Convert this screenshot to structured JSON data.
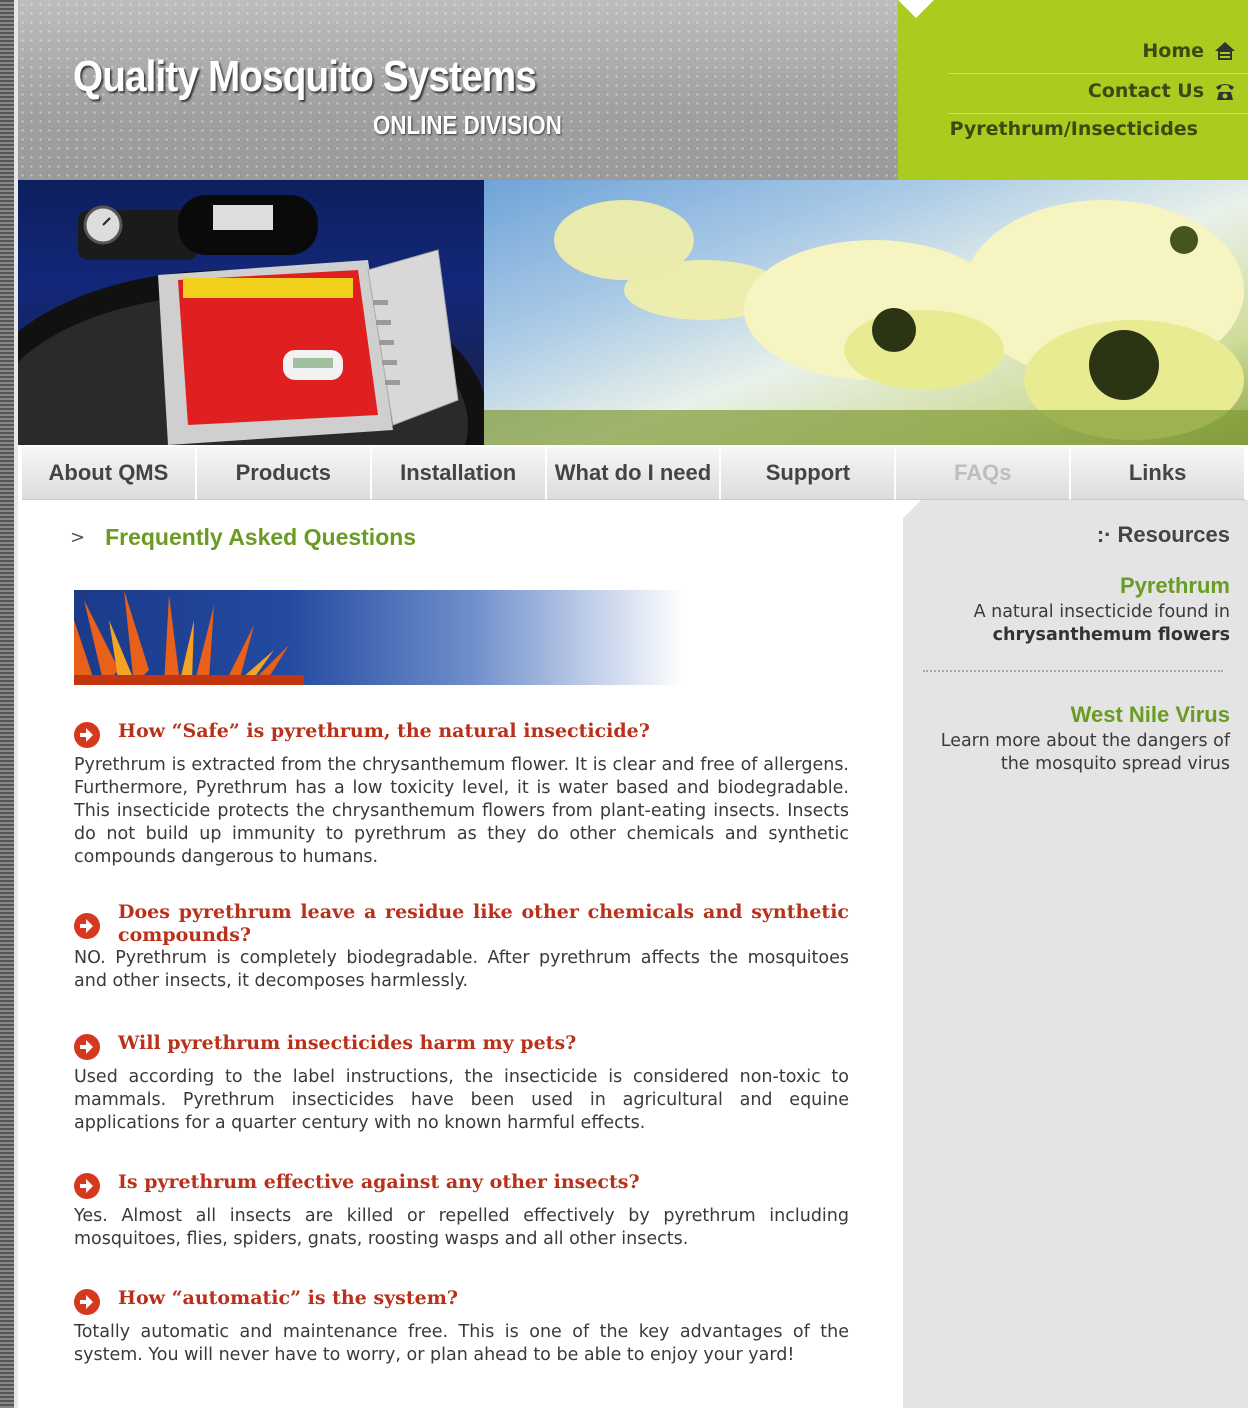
{
  "header": {
    "logo_main": "Quality Mosquito Systems",
    "logo_sub": "ONLINE DIVISION",
    "links": {
      "home": "Home",
      "contact": "Contact Us",
      "current": "Pyrethrum/Insecticides"
    },
    "icons": {
      "home": "home-icon",
      "contact": "telephone-icon"
    }
  },
  "banner": {
    "left_image": "mosquito-pro-control-unit-photo",
    "right_image": "chrysanthemum-flowers-photo"
  },
  "nav": {
    "items": [
      "About QMS",
      "Products",
      "Installation",
      "What do I need",
      "Support",
      "FAQs",
      "Links"
    ],
    "active": "FAQs"
  },
  "main": {
    "section_title": "Frequently Asked Questions",
    "faqs": [
      {
        "q": "How “Safe” is pyrethrum, the natural insecticide?",
        "a": "Pyrethrum is extracted from the chrysanthemum flower. It is clear and free of allergens. Furthermore, Pyrethrum has a low toxicity level, it is water based and biodegradable. This insecticide protects the chrysanthemum flowers from plant-eating insects. Insects do not build up immunity to pyrethrum as they do other chemicals and synthetic compounds dangerous to humans."
      },
      {
        "q": "Does pyrethrum leave a residue like other chemicals and synthetic compounds?",
        "a": "NO. Pyrethrum is completely biodegradable. After pyrethrum affects the mosquitoes and other insects, it decomposes harmlessly."
      },
      {
        "q": "Will pyrethrum insecticides harm my pets?",
        "a": "Used according to the label instructions, the insecticide is considered non-toxic to mammals. Pyrethrum insecticides have been used in agricultural and equine applications for a quarter century with no known harmful effects."
      },
      {
        "q": "Is pyrethrum effective against any other insects?",
        "a": "Yes. Almost all insects are killed or repelled effectively by pyrethrum including mosquitoes, flies, spiders, gnats, roosting wasps and all other insects."
      },
      {
        "q": "How “automatic” is the system?",
        "a": "Totally automatic and maintenance free. This is one of the key advantages of the system. You will never have to worry, or plan ahead to be able to enjoy your yard!"
      }
    ]
  },
  "sidebar": {
    "heading_prefix": ":·",
    "heading": "Resources",
    "items": [
      {
        "title": "Pyrethrum",
        "text": "A natural insecticide found in",
        "text_bold": "chrysanthemum flowers"
      },
      {
        "title": "West Nile Virus",
        "text": "Learn more about the dangers of the mosquito spread virus"
      }
    ]
  },
  "colors": {
    "accent_green": "#a9cc1e",
    "title_green": "#6a9b22",
    "question_red": "#b9311b",
    "bullet_red": "#d6381e"
  }
}
